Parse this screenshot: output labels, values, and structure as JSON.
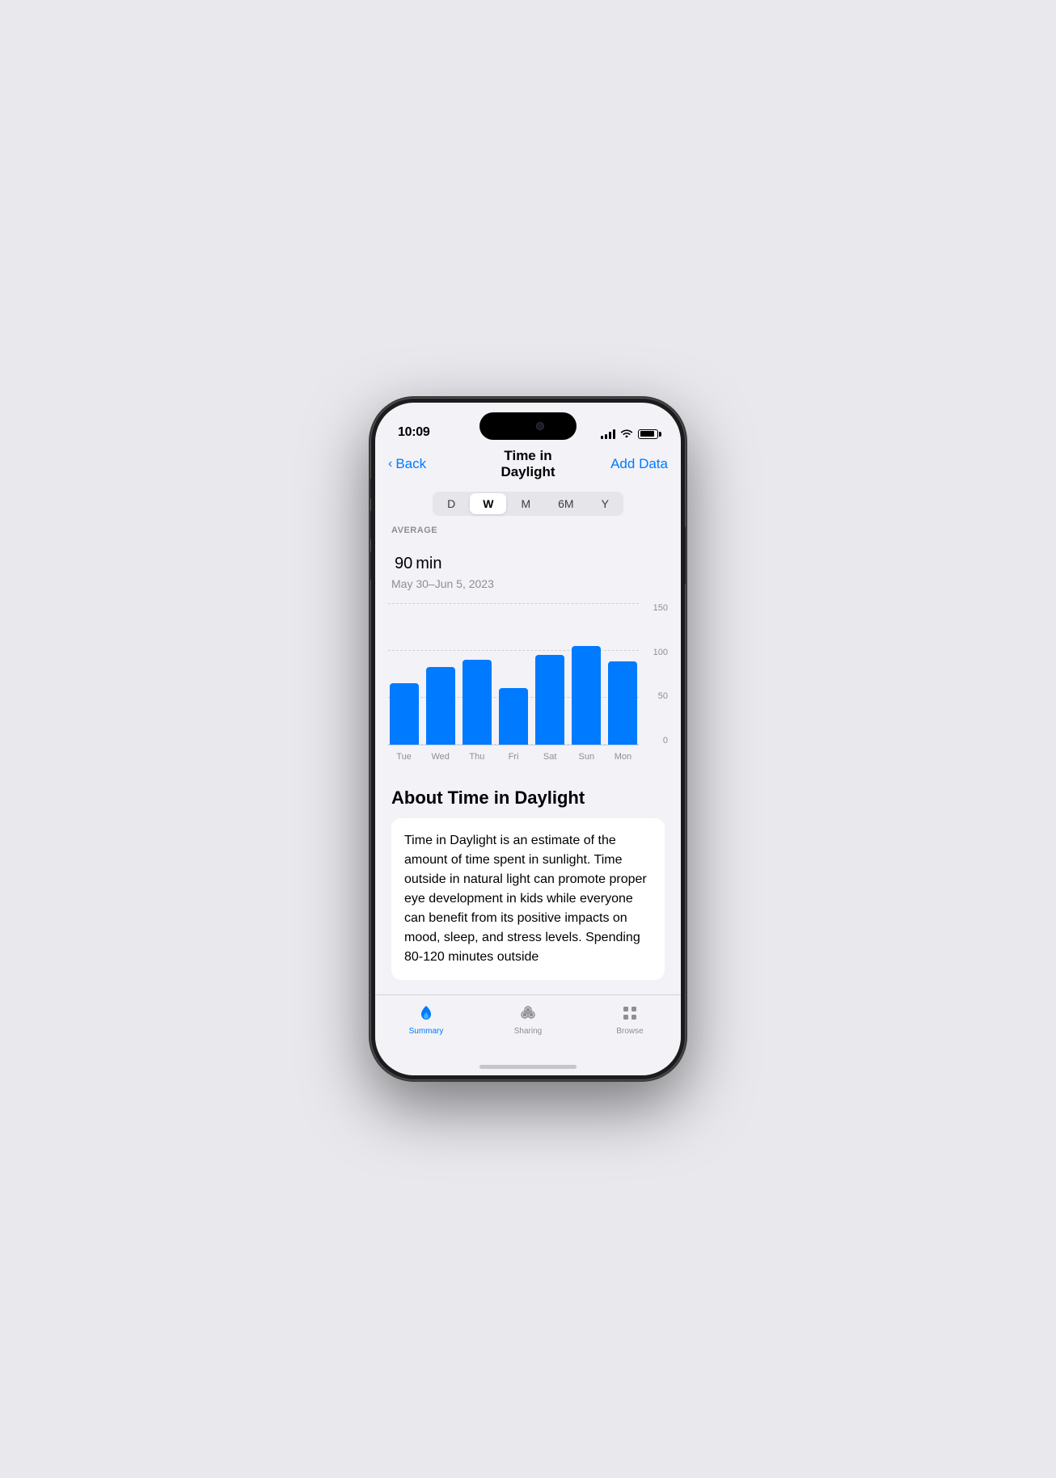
{
  "status_bar": {
    "time": "10:09"
  },
  "nav": {
    "back_label": "Back",
    "title": "Time in Daylight",
    "action_label": "Add Data"
  },
  "period_selector": {
    "tabs": [
      "D",
      "W",
      "M",
      "6M",
      "Y"
    ],
    "active_tab": "W"
  },
  "stats": {
    "label": "AVERAGE",
    "value": "90",
    "unit": "min",
    "date_range": "May 30–Jun 5, 2023"
  },
  "chart": {
    "y_labels": [
      "150",
      "100",
      "50",
      "0"
    ],
    "x_labels": [
      "Tue",
      "Wed",
      "Thu",
      "Fri",
      "Sat",
      "Sun",
      "Mon"
    ],
    "bars": [
      {
        "day": "Tue",
        "value": 65,
        "max": 150
      },
      {
        "day": "Wed",
        "value": 82,
        "max": 150
      },
      {
        "day": "Thu",
        "value": 90,
        "max": 150
      },
      {
        "day": "Fri",
        "value": 60,
        "max": 150
      },
      {
        "day": "Sat",
        "value": 95,
        "max": 150
      },
      {
        "day": "Sun",
        "value": 105,
        "max": 150
      },
      {
        "day": "Mon",
        "value": 88,
        "max": 150
      }
    ]
  },
  "about": {
    "title": "About Time in Daylight",
    "description": "Time in Daylight is an estimate of the amount of time spent in sunlight. Time outside in natural light can promote proper eye development in kids while everyone can benefit from its positive impacts on mood, sleep, and stress levels. Spending 80-120 minutes outside"
  },
  "tab_bar": {
    "items": [
      {
        "id": "summary",
        "label": "Summary",
        "active": true
      },
      {
        "id": "sharing",
        "label": "Sharing",
        "active": false
      },
      {
        "id": "browse",
        "label": "Browse",
        "active": false
      }
    ]
  }
}
